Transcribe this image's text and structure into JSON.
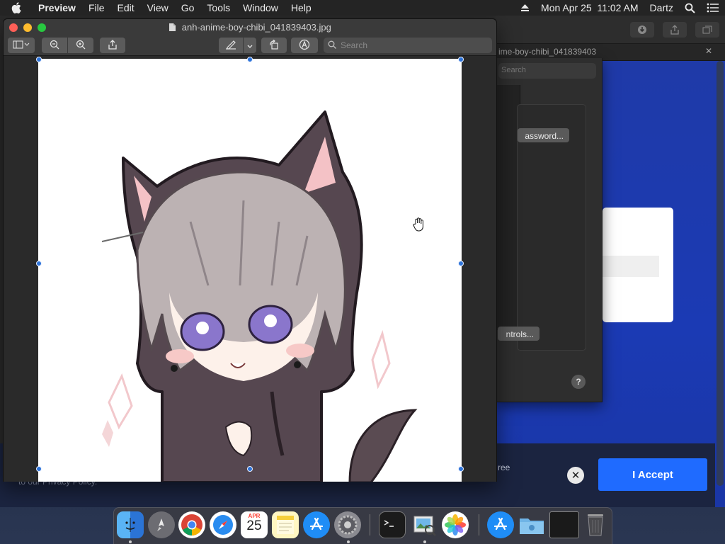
{
  "menubar": {
    "app_name": "Preview",
    "items": [
      "File",
      "Edit",
      "View",
      "Go",
      "Tools",
      "Window",
      "Help"
    ],
    "clock": "Mon Apr 25  11:02 AM",
    "user": "Dartz",
    "icons": [
      "apple-icon",
      "eject-icon",
      "spotlight-search-icon",
      "control-list-icon"
    ]
  },
  "preview": {
    "title": "anh-anime-boy-chibi_041839403.jpg",
    "search_placeholder": "Search",
    "toolbar_icons": [
      "sidebar-icon",
      "zoom-out-icon",
      "zoom-in-icon",
      "share-icon",
      "markup-pen-icon",
      "rotate-icon",
      "annotate-icon"
    ]
  },
  "browser": {
    "tab_title": "ime-boy-chibi_041839403",
    "cookie_text_right": "ree",
    "cookie_text_left": "to our Privacy Policy.",
    "accept_label": "I Accept",
    "close_glyph": "✕"
  },
  "settings": {
    "password_button": "assword...",
    "controls_button": "ntrols...",
    "search_placeholder": "Search",
    "help_glyph": "?"
  },
  "colors": {
    "accent_blue": "#1f6bff",
    "handle_blue": "#2d73d9",
    "traffic_close": "#fe5f57",
    "traffic_minimize": "#febc2e",
    "traffic_zoom": "#28c840"
  },
  "dock": {
    "calendar_month": "APR",
    "calendar_day": "25",
    "apps": [
      "finder-icon",
      "launchpad-icon",
      "chrome-icon",
      "safari-icon",
      "calendar-icon",
      "notes-icon",
      "app-store-icon",
      "system-preferences-icon",
      "terminal-icon",
      "preview-icon",
      "photos-icon",
      "app-store-downloads-icon",
      "folder-icon",
      "screenshot-icon",
      "trash-icon"
    ]
  }
}
